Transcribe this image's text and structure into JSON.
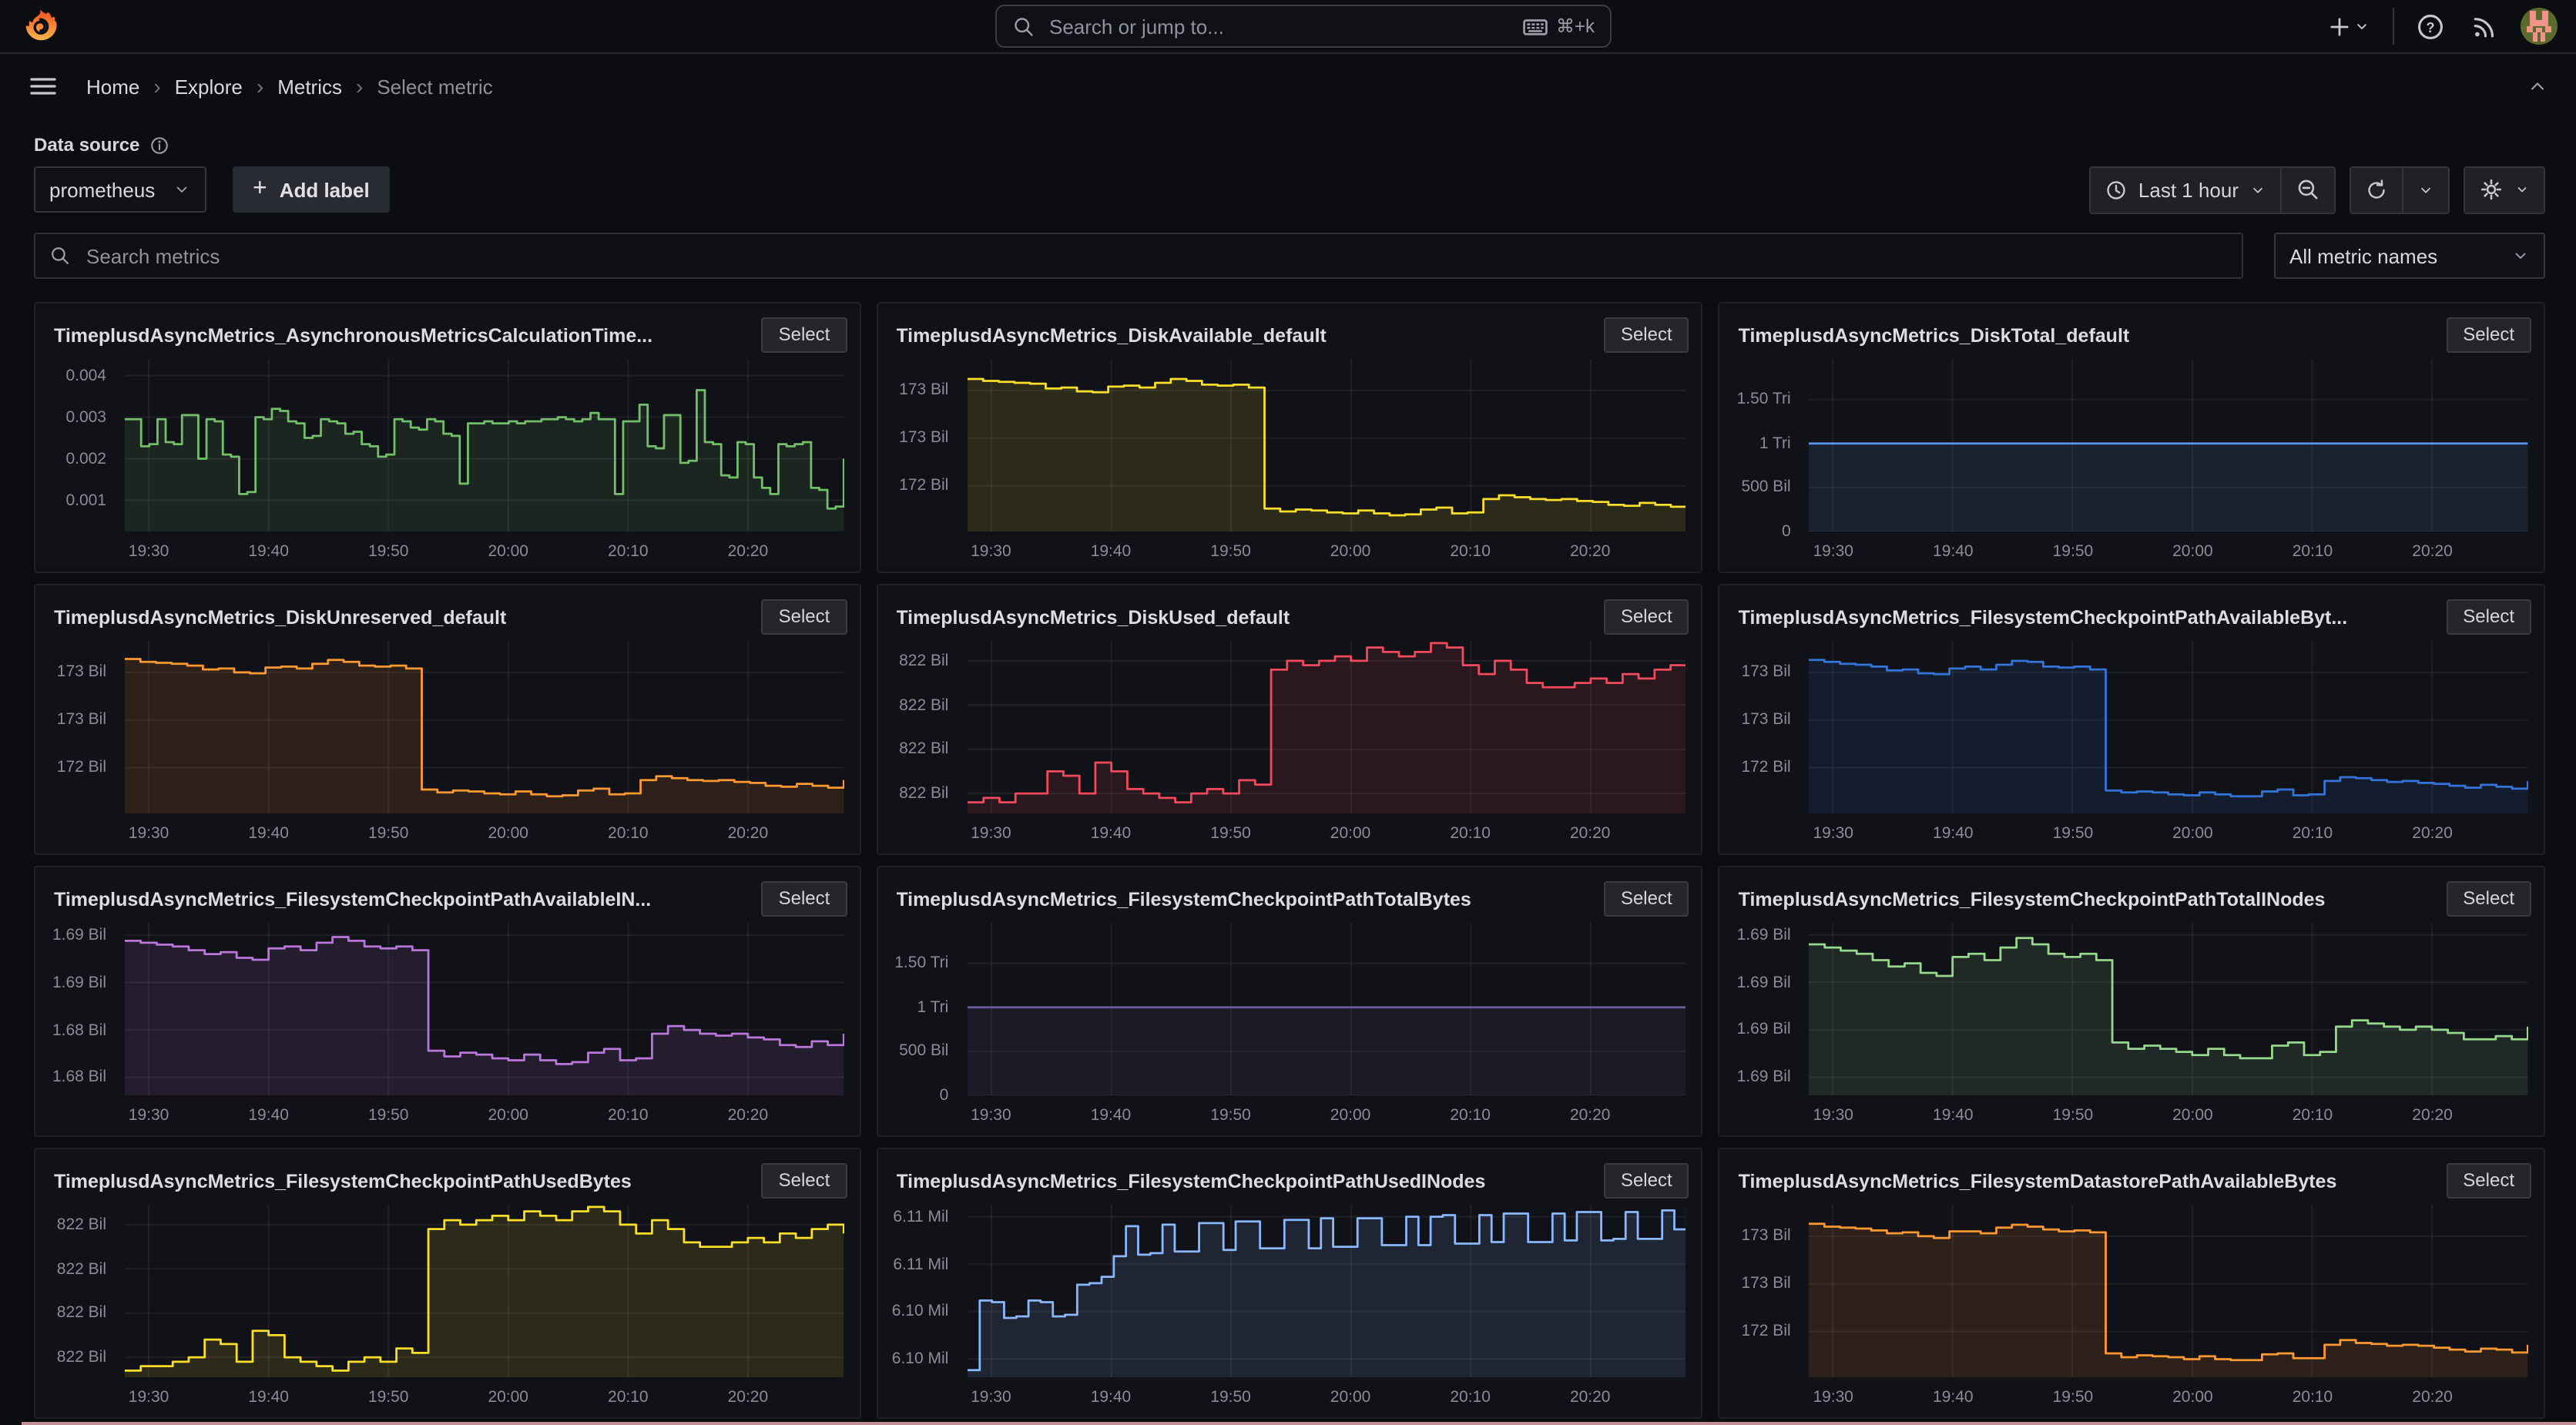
{
  "topbar": {
    "search_placeholder": "Search or jump to...",
    "shortcut": "⌘+k"
  },
  "nav": {
    "separator": "›",
    "breadcrumbs": [
      {
        "label": "Home"
      },
      {
        "label": "Explore"
      },
      {
        "label": "Metrics"
      },
      {
        "label": "Select metric"
      }
    ]
  },
  "controls": {
    "data_source_label": "Data source",
    "data_source_value": "prometheus",
    "add_label": "Add label",
    "add_label_plus": "+",
    "time_range": "Last 1 hour",
    "metrics_search_placeholder": "Search metrics",
    "metric_names_filter": "All metric names"
  },
  "select_label": "Select",
  "x_tick_labels": [
    "19:30",
    "19:40",
    "19:50",
    "20:00",
    "20:10",
    "20:20"
  ],
  "x_tick_fractions": [
    0.0333,
    0.2,
    0.3667,
    0.5333,
    0.7,
    0.8667
  ],
  "panels": [
    {
      "title": "TimeplusdAsyncMetrics_AsynchronousMetricsCalculationTime...",
      "type": "line-step",
      "color": "#73BF69",
      "ylim": [
        0.00025,
        0.0044
      ],
      "y_ticks": [
        {
          "label": "0.004",
          "value": 0.004
        },
        {
          "label": "0.003",
          "value": 0.003
        },
        {
          "label": "0.002",
          "value": 0.002
        },
        {
          "label": "0.001",
          "value": 0.001
        }
      ],
      "values": [
        0.00295,
        0.00295,
        0.0023,
        0.00235,
        0.00295,
        0.0024,
        0.00235,
        0.00305,
        0.00305,
        0.002,
        0.00295,
        0.0029,
        0.0021,
        0.00205,
        0.00115,
        0.0012,
        0.003,
        0.00295,
        0.0032,
        0.00315,
        0.0029,
        0.00285,
        0.0025,
        0.00255,
        0.00295,
        0.0029,
        0.00285,
        0.0026,
        0.00265,
        0.00235,
        0.0023,
        0.00205,
        0.0021,
        0.00295,
        0.0029,
        0.00275,
        0.0027,
        0.00295,
        0.0029,
        0.0026,
        0.00255,
        0.0014,
        0.00285,
        0.00285,
        0.0029,
        0.00285,
        0.00285,
        0.0029,
        0.00285,
        0.0029,
        0.0029,
        0.00295,
        0.00295,
        0.003,
        0.00295,
        0.0029,
        0.00295,
        0.0031,
        0.00295,
        0.00295,
        0.00115,
        0.0029,
        0.0029,
        0.0033,
        0.0023,
        0.00225,
        0.00305,
        0.00305,
        0.0019,
        0.00195,
        0.00365,
        0.0024,
        0.00235,
        0.0016,
        0.00155,
        0.0024,
        0.00235,
        0.00155,
        0.0013,
        0.00115,
        0.00235,
        0.0023,
        0.00235,
        0.0024,
        0.0013,
        0.00125,
        0.0008,
        0.00085,
        0.002
      ]
    },
    {
      "title": "TimeplusdAsyncMetrics_DiskAvailable_default",
      "type": "line-step",
      "color": "#FADE2A",
      "ylim": [
        171.52,
        173.33
      ],
      "y_ticks": [
        {
          "label": "173 Bil",
          "value": 173.0
        },
        {
          "label": "173 Bil",
          "value": 172.5
        },
        {
          "label": "172 Bil",
          "value": 172.0
        }
      ],
      "values": [
        173.12,
        173.1,
        173.09,
        173.08,
        173.07,
        173.02,
        173.03,
        172.99,
        172.98,
        173.04,
        173.05,
        173.03,
        173.08,
        173.12,
        173.1,
        173.06,
        173.05,
        173.06,
        173.03,
        171.76,
        171.73,
        171.75,
        171.74,
        171.72,
        171.71,
        171.74,
        171.71,
        171.69,
        171.7,
        171.75,
        171.77,
        171.71,
        171.72,
        171.86,
        171.9,
        171.88,
        171.86,
        171.85,
        171.86,
        171.84,
        171.83,
        171.8,
        171.79,
        171.82,
        171.8,
        171.78,
        171.86
      ]
    },
    {
      "title": "TimeplusdAsyncMetrics_DiskTotal_default",
      "type": "line-step",
      "color": "#5794F2",
      "ylim": [
        0,
        1.96
      ],
      "y_ticks": [
        {
          "label": "1.50 Tri",
          "value": 1.5
        },
        {
          "label": "1 Tri",
          "value": 1.0
        },
        {
          "label": "500 Bil",
          "value": 0.5
        },
        {
          "label": "0",
          "value": 0
        }
      ],
      "values": [
        1,
        1
      ]
    },
    {
      "title": "TimeplusdAsyncMetrics_DiskUnreserved_default",
      "type": "line-step",
      "color": "#FF9830",
      "ylim": [
        171.52,
        173.33
      ],
      "y_ticks": [
        {
          "label": "173 Bil",
          "value": 173.0
        },
        {
          "label": "173 Bil",
          "value": 172.5
        },
        {
          "label": "172 Bil",
          "value": 172.0
        }
      ],
      "values": [
        173.14,
        173.11,
        173.1,
        173.09,
        173.07,
        173.03,
        173.04,
        173.0,
        172.99,
        173.05,
        173.06,
        173.04,
        173.09,
        173.13,
        173.11,
        173.07,
        173.06,
        173.07,
        173.04,
        171.77,
        171.74,
        171.76,
        171.75,
        171.73,
        171.72,
        171.75,
        171.72,
        171.7,
        171.71,
        171.76,
        171.78,
        171.72,
        171.73,
        171.87,
        171.91,
        171.89,
        171.87,
        171.86,
        171.87,
        171.85,
        171.84,
        171.81,
        171.8,
        171.83,
        171.81,
        171.79,
        171.87
      ]
    },
    {
      "title": "TimeplusdAsyncMetrics_DiskUsed_default",
      "type": "line-step",
      "color": "#F2495C",
      "ylim": [
        821.555,
        821.945
      ],
      "y_ticks": [
        {
          "label": "822 Bil",
          "value": 821.9
        },
        {
          "label": "822 Bil",
          "value": 821.8
        },
        {
          "label": "822 Bil",
          "value": 821.7
        },
        {
          "label": "822 Bil",
          "value": 821.6
        }
      ],
      "values": [
        821.58,
        821.59,
        821.58,
        821.6,
        821.6,
        821.65,
        821.64,
        821.6,
        821.67,
        821.65,
        821.61,
        821.6,
        821.59,
        821.58,
        821.6,
        821.61,
        821.6,
        821.63,
        821.62,
        821.88,
        821.9,
        821.89,
        821.9,
        821.91,
        821.9,
        821.93,
        821.92,
        821.91,
        821.92,
        821.94,
        821.93,
        821.89,
        821.87,
        821.9,
        821.88,
        821.85,
        821.84,
        821.84,
        821.85,
        821.86,
        821.85,
        821.87,
        821.86,
        821.88,
        821.89,
        821.87
      ]
    },
    {
      "title": "TimeplusdAsyncMetrics_FilesystemCheckpointPathAvailableByt...",
      "type": "line-step",
      "color": "#3274D9",
      "ylim": [
        171.52,
        173.33
      ],
      "y_ticks": [
        {
          "label": "173 Bil",
          "value": 173.0
        },
        {
          "label": "173 Bil",
          "value": 172.5
        },
        {
          "label": "172 Bil",
          "value": 172.0
        }
      ],
      "values": [
        173.13,
        173.11,
        173.09,
        173.08,
        173.06,
        173.02,
        173.03,
        172.99,
        172.98,
        173.04,
        173.06,
        173.03,
        173.08,
        173.12,
        173.11,
        173.06,
        173.05,
        173.06,
        173.03,
        171.76,
        171.74,
        171.75,
        171.74,
        171.72,
        171.71,
        171.74,
        171.72,
        171.7,
        171.7,
        171.75,
        171.77,
        171.71,
        171.72,
        171.86,
        171.9,
        171.89,
        171.87,
        171.85,
        171.86,
        171.84,
        171.83,
        171.81,
        171.79,
        171.82,
        171.8,
        171.78,
        171.86
      ]
    },
    {
      "title": "TimeplusdAsyncMetrics_FilesystemCheckpointPathAvailableIN...",
      "type": "line-step",
      "color": "#B877D9",
      "ylim": [
        1.68155,
        1.69065
      ],
      "y_ticks": [
        {
          "label": "1.69 Bil",
          "value": 1.69
        },
        {
          "label": "1.69 Bil",
          "value": 1.6875
        },
        {
          "label": "1.68 Bil",
          "value": 1.685
        },
        {
          "label": "1.68 Bil",
          "value": 1.6825
        }
      ],
      "values": [
        1.6897,
        1.6896,
        1.6895,
        1.6894,
        1.6892,
        1.689,
        1.6891,
        1.6888,
        1.6887,
        1.6893,
        1.6894,
        1.6892,
        1.6896,
        1.6899,
        1.6897,
        1.6894,
        1.6893,
        1.6894,
        1.6892,
        1.6839,
        1.6836,
        1.6838,
        1.6837,
        1.6835,
        1.6834,
        1.6837,
        1.6834,
        1.6832,
        1.6833,
        1.6838,
        1.684,
        1.6834,
        1.6835,
        1.6848,
        1.6852,
        1.685,
        1.6848,
        1.6847,
        1.6848,
        1.6846,
        1.6845,
        1.6842,
        1.6841,
        1.6844,
        1.6842,
        1.6848
      ]
    },
    {
      "title": "TimeplusdAsyncMetrics_FilesystemCheckpointPathTotalBytes",
      "type": "line-step",
      "color": "#705DA0",
      "ylim": [
        0,
        1.96
      ],
      "y_ticks": [
        {
          "label": "1.50 Tri",
          "value": 1.5
        },
        {
          "label": "1 Tri",
          "value": 1.0
        },
        {
          "label": "500 Bil",
          "value": 0.5
        },
        {
          "label": "0",
          "value": 0
        }
      ],
      "values": [
        1,
        1
      ]
    },
    {
      "title": "TimeplusdAsyncMetrics_FilesystemCheckpointPathTotalINodes",
      "type": "line-step",
      "color": "#96D98D",
      "ylim": [
        1.68493,
        1.69038
      ],
      "y_ticks": [
        {
          "label": "1.69 Bil",
          "value": 1.69
        },
        {
          "label": "1.69 Bil",
          "value": 1.6885
        },
        {
          "label": "1.69 Bil",
          "value": 1.687
        },
        {
          "label": "1.69 Bil",
          "value": 1.6855
        }
      ],
      "values": [
        1.6897,
        1.6896,
        1.6895,
        1.6894,
        1.6892,
        1.689,
        1.6891,
        1.6888,
        1.6887,
        1.6893,
        1.6894,
        1.6892,
        1.6896,
        1.6899,
        1.6897,
        1.6894,
        1.6893,
        1.6894,
        1.6892,
        1.6866,
        1.6864,
        1.6865,
        1.6864,
        1.6863,
        1.6862,
        1.6864,
        1.6862,
        1.6861,
        1.6861,
        1.6865,
        1.6866,
        1.6862,
        1.6863,
        1.6871,
        1.6873,
        1.6872,
        1.6871,
        1.687,
        1.6871,
        1.687,
        1.6869,
        1.6867,
        1.6867,
        1.6868,
        1.6867,
        1.6871
      ]
    },
    {
      "title": "TimeplusdAsyncMetrics_FilesystemCheckpointPathUsedBytes",
      "type": "line-step",
      "color": "#FADE2A",
      "ylim": [
        821.555,
        821.945
      ],
      "y_ticks": [
        {
          "label": "822 Bil",
          "value": 821.9
        },
        {
          "label": "822 Bil",
          "value": 821.8
        },
        {
          "label": "822 Bil",
          "value": 821.7
        },
        {
          "label": "822 Bil",
          "value": 821.6
        }
      ],
      "values": [
        821.57,
        821.58,
        821.58,
        821.59,
        821.6,
        821.64,
        821.63,
        821.59,
        821.66,
        821.65,
        821.6,
        821.59,
        821.58,
        821.57,
        821.59,
        821.6,
        821.59,
        821.62,
        821.61,
        821.89,
        821.91,
        821.9,
        821.91,
        821.92,
        821.91,
        821.93,
        821.92,
        821.91,
        821.93,
        821.94,
        821.93,
        821.9,
        821.88,
        821.91,
        821.89,
        821.86,
        821.85,
        821.85,
        821.86,
        821.87,
        821.86,
        821.88,
        821.87,
        821.89,
        821.9,
        821.88
      ]
    },
    {
      "title": "TimeplusdAsyncMetrics_FilesystemCheckpointPathUsedINodes",
      "type": "line-step",
      "color": "#8AB8FF",
      "ylim": [
        6.09985,
        6.11076
      ],
      "y_ticks": [
        {
          "label": "6.11 Mil",
          "value": 6.11
        },
        {
          "label": "6.11 Mil",
          "value": 6.107
        },
        {
          "label": "6.10 Mil",
          "value": 6.104
        },
        {
          "label": "6.10 Mil",
          "value": 6.101
        }
      ],
      "values": [
        6.1003,
        6.1047,
        6.1046,
        6.1036,
        6.1037,
        6.1047,
        6.1046,
        6.1037,
        6.1038,
        6.1057,
        6.1058,
        6.1062,
        6.1075,
        6.1094,
        6.1076,
        6.1077,
        6.1095,
        6.1078,
        6.1078,
        6.1096,
        6.1096,
        6.1079,
        6.1097,
        6.1097,
        6.108,
        6.108,
        6.1098,
        6.1098,
        6.108,
        6.1099,
        6.1081,
        6.1081,
        6.1099,
        6.1099,
        6.1082,
        6.1082,
        6.11,
        6.1082,
        6.11,
        6.1101,
        6.1083,
        6.1083,
        6.1101,
        6.1084,
        6.1102,
        6.1102,
        6.1084,
        6.1084,
        6.1102,
        6.1085,
        6.1103,
        6.1103,
        6.1085,
        6.1086,
        6.1103,
        6.1086,
        6.1086,
        6.1104,
        6.1092,
        6.1108
      ]
    },
    {
      "title": "TimeplusdAsyncMetrics_FilesystemDatastorePathAvailableBytes",
      "type": "line-step",
      "color": "#FF9830",
      "ylim": [
        171.52,
        173.33
      ],
      "y_ticks": [
        {
          "label": "173 Bil",
          "value": 173.0
        },
        {
          "label": "173 Bil",
          "value": 172.5
        },
        {
          "label": "172 Bil",
          "value": 172.0
        }
      ],
      "values": [
        173.13,
        173.1,
        173.09,
        173.08,
        173.06,
        173.03,
        173.04,
        173.0,
        172.98,
        173.05,
        173.05,
        173.03,
        173.09,
        173.12,
        173.1,
        173.07,
        173.05,
        173.06,
        173.04,
        171.77,
        171.73,
        171.75,
        171.74,
        171.73,
        171.71,
        171.74,
        171.71,
        171.7,
        171.7,
        171.76,
        171.77,
        171.72,
        171.72,
        171.86,
        171.91,
        171.88,
        171.87,
        171.85,
        171.86,
        171.85,
        171.83,
        171.81,
        171.79,
        171.82,
        171.81,
        171.78,
        171.86
      ]
    }
  ]
}
